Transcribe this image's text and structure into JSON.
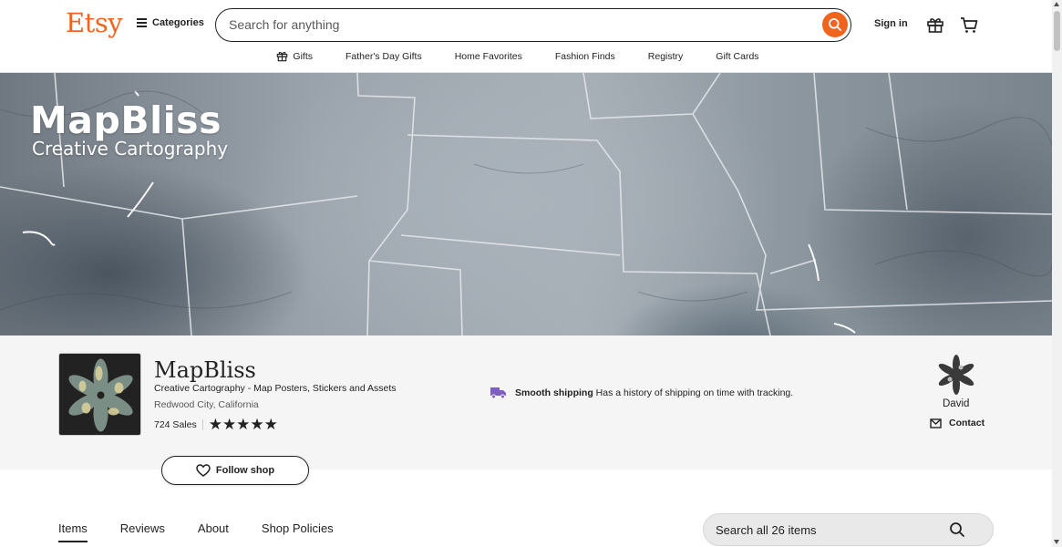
{
  "header": {
    "logo": "Etsy",
    "categories_label": "Categories",
    "search_placeholder": "Search for anything",
    "signin_label": "Sign in"
  },
  "subnav": {
    "items": [
      "Gifts",
      "Father's Day Gifts",
      "Home Favorites",
      "Fashion Finds",
      "Registry",
      "Gift Cards"
    ]
  },
  "banner": {
    "title": "MapBliss",
    "subtitle": "Creative Cartography"
  },
  "shop": {
    "name": "MapBliss",
    "tagline": "Creative Cartography - Map Posters, Stickers and Assets",
    "location": "Redwood City, California",
    "sales": "724 Sales",
    "rating_stars": 5,
    "stars_text": "★★★★★",
    "shipping_title": "Smooth shipping",
    "shipping_text": "Has a history of shipping on time with tracking.",
    "owner_name": "David",
    "contact_label": "Contact",
    "follow_label": "Follow shop"
  },
  "tabs": {
    "items": [
      "Items",
      "Reviews",
      "About",
      "Shop Policies"
    ],
    "active": "Items"
  },
  "items_search": {
    "placeholder": "Search all 26 items"
  },
  "colors": {
    "brand": "#f1641e",
    "text": "#222222",
    "shipping_icon": "#7f5fc4",
    "shop_bg": "#f5f5f5"
  },
  "icons": [
    "hamburger-icon",
    "search-icon",
    "gift-icon",
    "cart-icon",
    "truck-icon",
    "mail-icon",
    "heart-icon"
  ]
}
